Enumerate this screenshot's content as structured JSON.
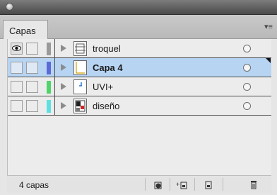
{
  "panel": {
    "tab_label": "Capas",
    "menu_icon": "panel-menu-icon"
  },
  "layers": [
    {
      "name": "troquel",
      "color": "#9a9a9a",
      "visible": true,
      "selected": false
    },
    {
      "name": "Capa 4",
      "color": "#5b6ad6",
      "visible": false,
      "selected": true
    },
    {
      "name": "UVI+",
      "color": "#4fd46a",
      "visible": false,
      "selected": false
    },
    {
      "name": "diseño",
      "color": "#5fe0e0",
      "visible": false,
      "selected": false
    }
  ],
  "footer": {
    "count_label": "4 capas",
    "buttons": [
      "make-clipping-mask-icon",
      "create-sublayer-icon",
      "create-new-layer-icon",
      "trash-icon"
    ]
  }
}
